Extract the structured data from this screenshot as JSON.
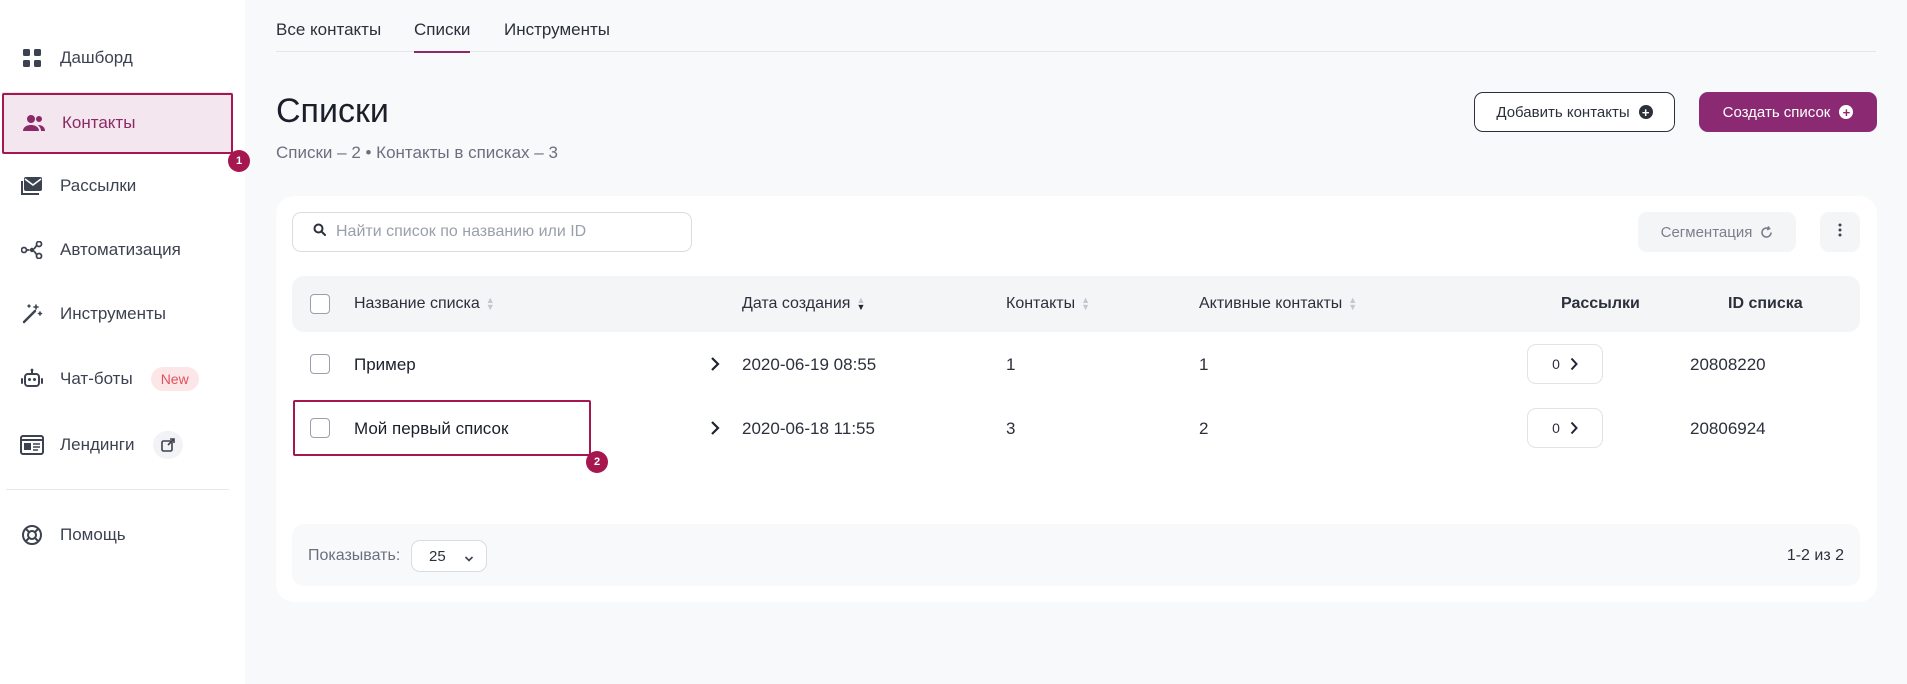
{
  "sidebar": {
    "items": [
      {
        "label": "Дашборд",
        "icon": "grid-icon"
      },
      {
        "label": "Контакты",
        "icon": "users-icon",
        "active": true
      },
      {
        "label": "Рассылки",
        "icon": "mail-icon"
      },
      {
        "label": "Автоматизация",
        "icon": "share-nodes-icon"
      },
      {
        "label": "Инструменты",
        "icon": "magic-wand-icon"
      },
      {
        "label": "Чат-боты",
        "icon": "robot-icon",
        "badge": "New"
      },
      {
        "label": "Лендинги",
        "icon": "landing-page-icon",
        "external": true
      },
      {
        "label": "Помощь",
        "icon": "lifebuoy-icon"
      }
    ],
    "markers": [
      "1",
      "2"
    ]
  },
  "tabs": [
    {
      "label": "Все контакты"
    },
    {
      "label": "Списки",
      "active": true
    },
    {
      "label": "Инструменты"
    }
  ],
  "page": {
    "title": "Списки",
    "subtitle": "Списки – 2 • Контакты в списках – 3",
    "add_contacts_label": "Добавить контакты",
    "create_list_label": "Создать список"
  },
  "search": {
    "placeholder": "Найти список по названию или ID"
  },
  "segmentation_label": "Сегментация",
  "table": {
    "headers": {
      "name": "Название списка",
      "created": "Дата создания",
      "contacts": "Контакты",
      "active": "Активные контакты",
      "mailings": "Рассылки",
      "id": "ID списка"
    },
    "rows": [
      {
        "name": "Пример",
        "created": "2020-06-19 08:55",
        "contacts": "1",
        "active": "1",
        "mailings": "0",
        "id": "20808220"
      },
      {
        "name": "Мой первый список",
        "created": "2020-06-18 11:55",
        "contacts": "3",
        "active": "2",
        "mailings": "0",
        "id": "20806924"
      }
    ]
  },
  "footer": {
    "show_label": "Показывать:",
    "per_page": "25",
    "pagination": "1-2 из 2"
  },
  "colors": {
    "accent": "#8b2a73",
    "highlight": "#a6174f",
    "new_badge_bg": "#fde6e8"
  }
}
